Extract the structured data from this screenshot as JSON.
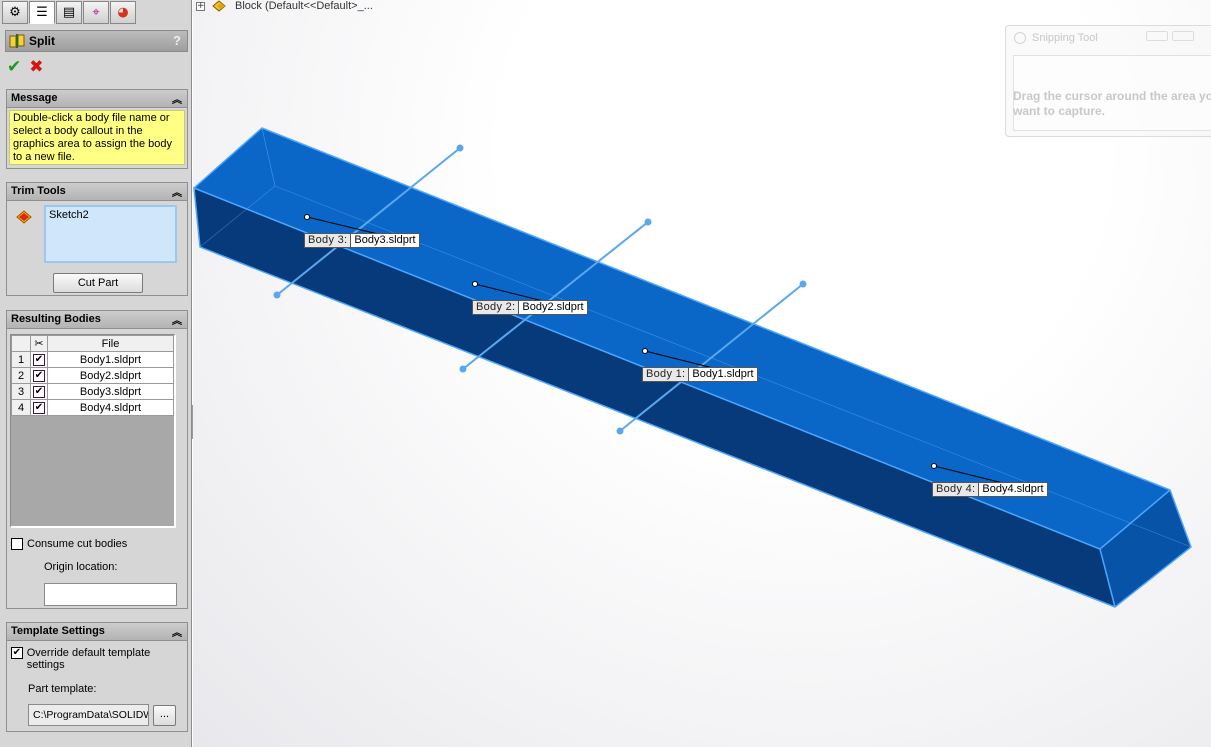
{
  "manager_tabs": [
    {
      "icon": "feature-manager-icon",
      "glyph": "⚙"
    },
    {
      "icon": "property-manager-icon",
      "glyph": "☰"
    },
    {
      "icon": "configuration-manager-icon",
      "glyph": "▤"
    },
    {
      "icon": "dimxpert-manager-icon",
      "glyph": "⌖"
    },
    {
      "icon": "display-manager-icon",
      "glyph": "◕"
    }
  ],
  "property_manager": {
    "title": "Split",
    "help": "?",
    "ok": "✔",
    "cancel": "✖"
  },
  "message": {
    "header": "Message",
    "text": "Double-click a body file name or select a body callout in the graphics area to assign the body to a new file."
  },
  "trim_tools": {
    "header": "Trim Tools",
    "selection": "Sketch2",
    "cut_part_label": "Cut Part"
  },
  "resulting_bodies": {
    "header": "Resulting Bodies",
    "col_file": "File",
    "rows": [
      {
        "num": "1",
        "checked": "✔",
        "file": "Body1.sldprt"
      },
      {
        "num": "2",
        "checked": "✔",
        "file": "Body2.sldprt"
      },
      {
        "num": "3",
        "checked": "✔",
        "file": "Body3.sldprt"
      },
      {
        "num": "4",
        "checked": "✔",
        "file": "Body4.sldprt"
      }
    ],
    "consume_label": "Consume cut bodies",
    "origin_label": "Origin location:"
  },
  "template_settings": {
    "header": "Template Settings",
    "override_label": "Override default template settings",
    "override_checked": "✔",
    "part_template_label": "Part template:",
    "part_template_path": "C:\\ProgramData\\SOLIDWORKS",
    "browse_label": "..."
  },
  "tree": {
    "expander": "+",
    "label": "Block  (Default<<Default>_..."
  },
  "snipping_tool": {
    "title": "Snipping Tool",
    "text": "Drag the cursor around the area you want to capture."
  },
  "callouts": [
    {
      "name": "Body  3:",
      "file": "Body3.sldprt"
    },
    {
      "name": "Body  2:",
      "file": "Body2.sldprt"
    },
    {
      "name": "Body  1:",
      "file": "Body1.sldprt"
    },
    {
      "name": "Body  4:",
      "file": "Body4.sldprt"
    }
  ],
  "colors": {
    "body_top": "#0a67c8",
    "body_front": "#063a7a",
    "edge": "#4da6ff",
    "sketch_line": "#5aa7ee",
    "message_bg": "#ffff84"
  }
}
